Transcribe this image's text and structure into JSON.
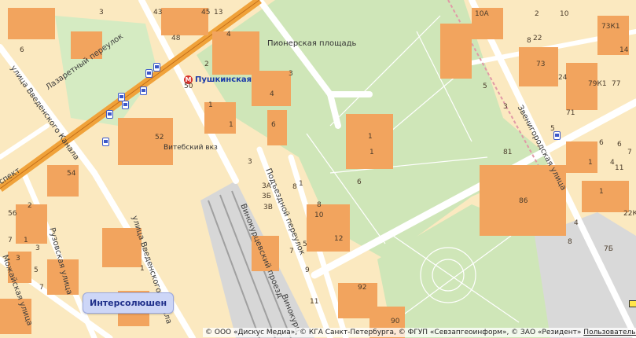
{
  "map": {
    "metro_station": "Пушкинская",
    "metro_icon": "metro-icon",
    "station_name": "Витебский вкз",
    "square_name": "Пионерская площадь",
    "tooltip": "Интерсолюшен",
    "copyright": "© ООО «Дискус Медиа», © КГА Санкт-Петербурга, © ФГУП «Севзапгеоинформ», © ЗАО «Резидент»",
    "copyright_link": "Пользовательс",
    "streets": {
      "lazaretny": "Лазаретный переулок",
      "vvedensky_left": "улица Введенского Канала",
      "vvedensky_bottom": "улица Введенского Канала",
      "ruzovskaya": "Рузовская улица",
      "mozhayskaya": "Можайская улица",
      "podyezdnoy": "Подъездной переулок",
      "vinokurtsevsky": "Винокурцевский проезд",
      "vinokurtsevsky2": "Винокурц",
      "zvenigorodskaya": "Звенигородская улица",
      "prospekt": "спект"
    },
    "house_numbers": [
      "3",
      "43",
      "45",
      "13",
      "48",
      "4",
      "2",
      "6",
      "3",
      "50",
      "1",
      "1",
      "4",
      "52",
      "6",
      "1",
      "1",
      "1",
      "3",
      "8",
      "3А",
      "3Б",
      "3В",
      "6",
      "8",
      "10",
      "12",
      "7",
      "5",
      "9",
      "11",
      "92",
      "90",
      "54",
      "56",
      "2",
      "1",
      "3",
      "7",
      "1",
      "5",
      "3",
      "7",
      "10А",
      "2",
      "10",
      "8",
      "22",
      "73К1",
      "14",
      "73",
      "24",
      "79К1",
      "77",
      "5",
      "3",
      "71",
      "81",
      "6",
      "1",
      "86",
      "11",
      "22К",
      "4",
      "7Б",
      "8",
      "1",
      "4",
      "6",
      "5",
      "7"
    ]
  }
}
